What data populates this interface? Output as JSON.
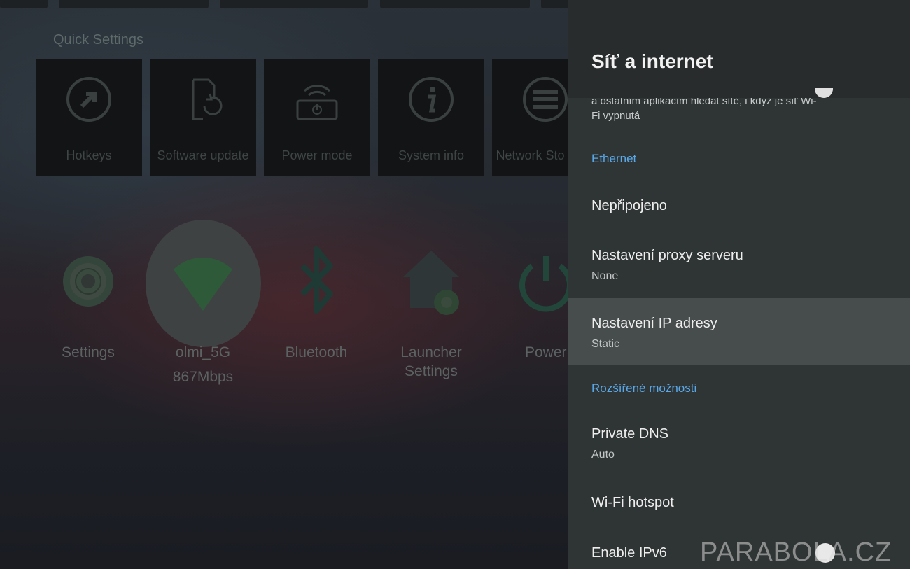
{
  "launcher": {
    "quick_settings_title": "Quick Settings",
    "tiles": [
      {
        "label": "Hotkeys",
        "icon": "hotkeys-icon"
      },
      {
        "label": "Software update",
        "icon": "software-update-icon"
      },
      {
        "label": "Power mode",
        "icon": "power-mode-icon"
      },
      {
        "label": "System info",
        "icon": "system-info-icon"
      },
      {
        "label": "Network Sto",
        "icon": "network-storage-icon"
      }
    ],
    "apps": [
      {
        "label": "Settings",
        "icon": "settings-icon"
      },
      {
        "label": "olmi_5G",
        "sublabel": "867Mbps",
        "icon": "wifi-icon"
      },
      {
        "label": "Bluetooth",
        "icon": "bluetooth-icon"
      },
      {
        "label": "Launcher",
        "sublabel": "Settings",
        "icon": "launcher-settings-icon"
      },
      {
        "label": "Power",
        "icon": "power-icon"
      }
    ]
  },
  "panel": {
    "title": "Síť a internet",
    "partial_text": "a ostatním aplikacím hledat sítě, i když je síť Wi-Fi vypnutá",
    "section_ethernet": "Ethernet",
    "section_advanced": "Rozšířené možnosti",
    "items": [
      {
        "title": "Nepřipojeno"
      },
      {
        "title": "Nastavení proxy serveru",
        "subtitle": "None"
      },
      {
        "title": "Nastavení IP adresy",
        "subtitle": "Static"
      },
      {
        "title": "Private DNS",
        "subtitle": "Auto"
      },
      {
        "title": "Wi-Fi hotspot"
      },
      {
        "title": "Enable IPv6"
      }
    ],
    "accent_color": "#5aa8e8"
  },
  "watermark": "PARABOLA.CZ"
}
